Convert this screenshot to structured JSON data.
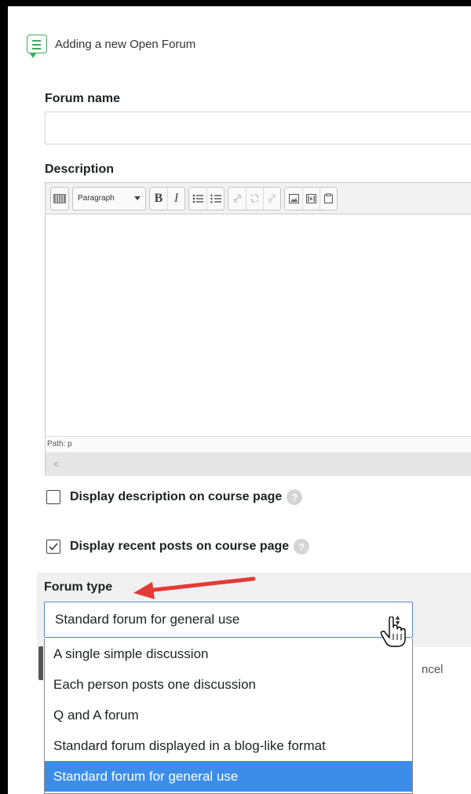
{
  "header": {
    "title": "Adding a new Open Forum",
    "icon": "forum-icon"
  },
  "forum_name": {
    "label": "Forum name",
    "value": ""
  },
  "description": {
    "label": "Description",
    "toolbar": {
      "format_select": "Paragraph",
      "bold": "B",
      "italic": "I"
    },
    "path": "Path: p",
    "scroll_left": "<"
  },
  "checkboxes": [
    {
      "label": "Display description on course page",
      "checked": false,
      "help": "?"
    },
    {
      "label": "Display recent posts on course page",
      "checked": true,
      "help": "?"
    }
  ],
  "forum_type": {
    "label": "Forum type",
    "selected": "Standard forum for general use",
    "options": [
      "A single simple discussion",
      "Each person posts one discussion",
      "Q and A forum",
      "Standard forum displayed in a blog-like format",
      "Standard forum for general use"
    ],
    "highlighted_index": 4
  },
  "partial_text": {
    "cancel": "ncel"
  },
  "colors": {
    "highlight": "#3c8dea",
    "annotation_arrow": "#e53935",
    "icon_green": "#3cae5b"
  }
}
